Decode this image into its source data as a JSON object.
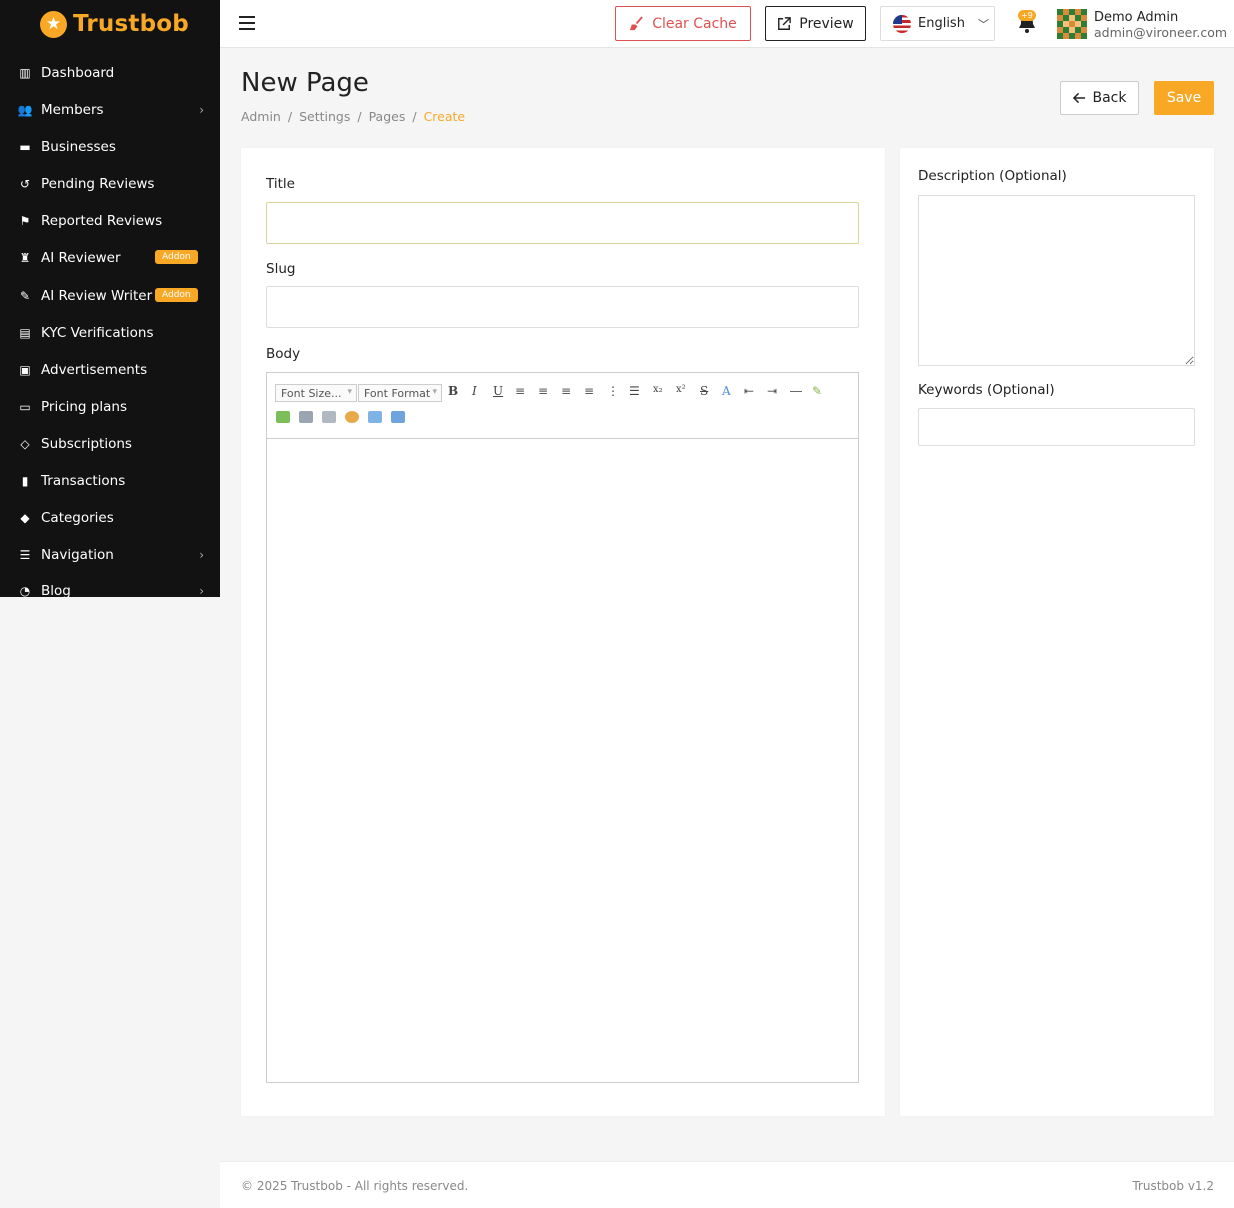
{
  "brand": {
    "name": "Trustbob",
    "accent": "#f9a825"
  },
  "sidebar": {
    "items": [
      {
        "label": "Dashboard",
        "icon": "dashboard-icon",
        "chevron": false
      },
      {
        "label": "Members",
        "icon": "users-icon",
        "chevron": true
      },
      {
        "label": "Businesses",
        "icon": "briefcase-icon",
        "chevron": false
      },
      {
        "label": "Pending Reviews",
        "icon": "history-icon",
        "chevron": false
      },
      {
        "label": "Reported Reviews",
        "icon": "flag-icon",
        "chevron": false
      },
      {
        "label": "AI Reviewer",
        "icon": "robot-icon",
        "chevron": false,
        "badge": "Addon"
      },
      {
        "label": "AI Review Writer",
        "icon": "pencil-icon",
        "chevron": false,
        "badge": "Addon"
      },
      {
        "label": "KYC Verifications",
        "icon": "id-card-icon",
        "chevron": false
      },
      {
        "label": "Advertisements",
        "icon": "ad-icon",
        "chevron": false
      },
      {
        "label": "Pricing plans",
        "icon": "pricing-icon",
        "chevron": false
      },
      {
        "label": "Subscriptions",
        "icon": "gem-icon",
        "chevron": false
      },
      {
        "label": "Transactions",
        "icon": "receipt-icon",
        "chevron": false
      },
      {
        "label": "Categories",
        "icon": "tag-icon",
        "chevron": false
      },
      {
        "label": "Navigation",
        "icon": "list-icon",
        "chevron": true
      },
      {
        "label": "Blog",
        "icon": "rss-icon",
        "chevron": true
      }
    ]
  },
  "topbar": {
    "clear_cache": "Clear Cache",
    "preview": "Preview",
    "language": "English",
    "notifications_badge": "+9",
    "user_name": "Demo Admin",
    "user_email": "admin@vironeer.com"
  },
  "page": {
    "title": "New Page",
    "breadcrumb": [
      "Admin",
      "Settings",
      "Pages",
      "Create"
    ],
    "back_label": "Back",
    "save_label": "Save"
  },
  "form": {
    "title_label": "Title",
    "title_value": "",
    "slug_label": "Slug",
    "slug_value": "",
    "body_label": "Body",
    "font_size_placeholder": "Font Size...",
    "font_format_placeholder": "Font Format",
    "description_label": "Description (Optional)",
    "description_value": "",
    "keywords_label": "Keywords (Optional)",
    "keywords_value": ""
  },
  "footer": {
    "copyright": "© 2025 Trustbob - All rights reserved.",
    "version": "Trustbob v1.2"
  }
}
